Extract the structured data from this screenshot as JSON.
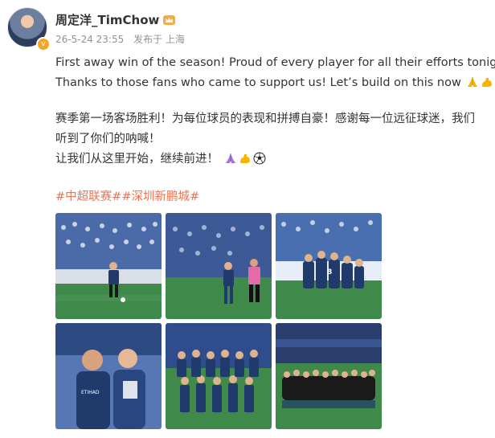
{
  "author": {
    "name": "周定洋_TimChow",
    "avatar_icon": "avatar-photo",
    "verified_icon": "verified-badge-icon",
    "badge_icon": "crown-icon"
  },
  "meta": {
    "timestamp": "26-5-24 23:55",
    "location": "发布于 上海"
  },
  "post": {
    "en_line1": "First away win of the season! Proud of every player for all their efforts tonight!",
    "en_line2": "Thanks to those fans who came to support us! Let’s build on this now",
    "cn_line1": "赛季第一场客场胜利！为每位球员的表现和拼搏自豪！感谢每一位远征球迷，我们",
    "cn_line2": "听到了你们的呐喊！",
    "cn_line3": "让我们从这里开始，继续前进！",
    "emojis": [
      "folded-hands",
      "flexed-bicep",
      "soccer-ball"
    ]
  },
  "hashtags": [
    "#中超联赛#",
    "#深圳新鹏城#"
  ],
  "photos": [
    {
      "name": "photo-player-dribbling"
    },
    {
      "name": "photo-referee-and-player"
    },
    {
      "name": "photo-team-celebration"
    },
    {
      "name": "photo-selfie-with-coach"
    },
    {
      "name": "photo-team-lineup"
    },
    {
      "name": "photo-group-in-stadium"
    }
  ],
  "colors": {
    "accent": "#eb7350",
    "meta_gray": "#939393",
    "text": "#333333",
    "team_blue": "#1f3a6b",
    "pitch_green": "#3f8a4a"
  }
}
